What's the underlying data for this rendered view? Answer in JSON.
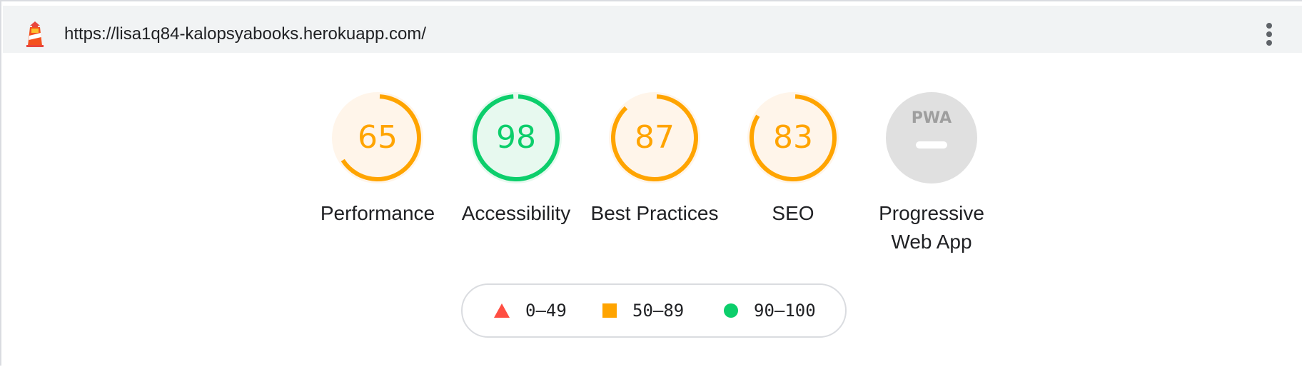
{
  "header": {
    "url": "https://lisa1q84-kalopsyabooks.herokuapp.com/",
    "logo_icon": "lighthouse-icon",
    "menu_icon": "more-vertical-icon"
  },
  "gauges": [
    {
      "id": "performance",
      "score": "65",
      "value": 65,
      "label": "Performance",
      "status": "average"
    },
    {
      "id": "accessibility",
      "score": "98",
      "value": 98,
      "label": "Accessibility",
      "status": "pass"
    },
    {
      "id": "best-practices",
      "score": "87",
      "value": 87,
      "label": "Best Practices",
      "status": "average"
    },
    {
      "id": "seo",
      "score": "83",
      "value": 83,
      "label": "SEO",
      "status": "average"
    },
    {
      "id": "pwa",
      "score": "",
      "value": null,
      "label": "Progressive Web App",
      "status": "na",
      "icon": "pwa-badge-icon",
      "badge_text": "PWA"
    }
  ],
  "legend": [
    {
      "shape": "triangle",
      "range": "0–49",
      "color": "#ff4e42"
    },
    {
      "shape": "square",
      "range": "50–89",
      "color": "#ffa400"
    },
    {
      "shape": "circle",
      "range": "90–100",
      "color": "#0cce6b"
    }
  ],
  "colors": {
    "average_stroke": "#ffa400",
    "average_fill": "#fff5ea",
    "average_text": "#ffa400",
    "pass_stroke": "#0cce6b",
    "pass_fill": "#e7f9ef",
    "pass_text": "#0cce6b",
    "na_fill": "#e0e0e0"
  }
}
